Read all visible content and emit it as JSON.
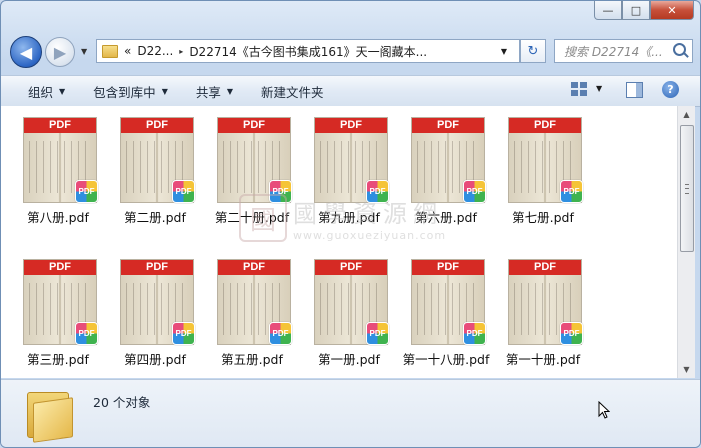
{
  "window": {
    "min_label": "—",
    "max_label": "□",
    "close_label": "✕"
  },
  "nav": {
    "back_icon": "◀",
    "forward_icon": "▶",
    "dropdown": "▼"
  },
  "address": {
    "prefix": "«",
    "seg1": "D22...",
    "sep": "▸",
    "seg2": "D22714《古今图书集成161》天一阁藏本...",
    "dropdown": "▼"
  },
  "refresh_icon": "↻",
  "search": {
    "placeholder": "搜索 D22714《..."
  },
  "toolbar": {
    "organize": "组织",
    "include_library": "包含到库中",
    "share": "共享",
    "new_folder": "新建文件夹",
    "caret": "▼",
    "help": "?"
  },
  "files": [
    {
      "name": "第八册.pdf"
    },
    {
      "name": "第二册.pdf"
    },
    {
      "name": "第二十册.pdf"
    },
    {
      "name": "第九册.pdf"
    },
    {
      "name": "第六册.pdf"
    },
    {
      "name": "第七册.pdf"
    },
    {
      "name": "第三册.pdf"
    },
    {
      "name": "第四册.pdf"
    },
    {
      "name": "第五册.pdf"
    },
    {
      "name": "第一册.pdf"
    },
    {
      "name": "第一十八册.pdf"
    },
    {
      "name": "第一十册.pdf"
    }
  ],
  "pdf_banner": "PDF",
  "pdf_badge": "PDF",
  "watermark": {
    "logo": "國",
    "title": "國學資源網",
    "url": "www.guoxueziyuan.com"
  },
  "status": {
    "count": "20 个对象"
  }
}
